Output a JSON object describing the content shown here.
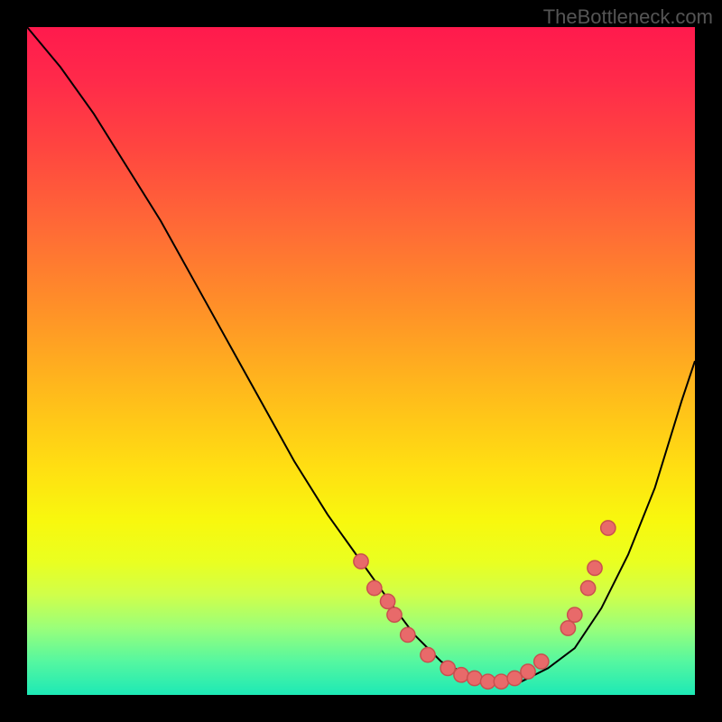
{
  "attribution": "TheBottleneck.com",
  "chart_data": {
    "type": "line",
    "title": "",
    "xlabel": "",
    "ylabel": "",
    "xlim": [
      0,
      100
    ],
    "ylim": [
      0,
      100
    ],
    "series": [
      {
        "name": "curve",
        "x": [
          0,
          5,
          10,
          15,
          20,
          25,
          30,
          35,
          40,
          45,
          50,
          55,
          58,
          62,
          66,
          70,
          74,
          78,
          82,
          86,
          90,
          94,
          98,
          100
        ],
        "y": [
          100,
          94,
          87,
          79,
          71,
          62,
          53,
          44,
          35,
          27,
          20,
          13,
          9,
          5,
          3,
          2,
          2,
          4,
          7,
          13,
          21,
          31,
          44,
          50
        ]
      }
    ],
    "markers": [
      {
        "x": 50,
        "y": 20
      },
      {
        "x": 52,
        "y": 16
      },
      {
        "x": 54,
        "y": 14
      },
      {
        "x": 55,
        "y": 12
      },
      {
        "x": 57,
        "y": 9
      },
      {
        "x": 60,
        "y": 6
      },
      {
        "x": 63,
        "y": 4
      },
      {
        "x": 65,
        "y": 3
      },
      {
        "x": 67,
        "y": 2.5
      },
      {
        "x": 69,
        "y": 2
      },
      {
        "x": 71,
        "y": 2
      },
      {
        "x": 73,
        "y": 2.5
      },
      {
        "x": 75,
        "y": 3.5
      },
      {
        "x": 77,
        "y": 5
      },
      {
        "x": 81,
        "y": 10
      },
      {
        "x": 82,
        "y": 12
      },
      {
        "x": 84,
        "y": 16
      },
      {
        "x": 85,
        "y": 19
      },
      {
        "x": 87,
        "y": 25
      }
    ],
    "colors": {
      "curve": "#000000",
      "marker_fill": "#e86a6a",
      "marker_stroke": "#c94f4f"
    }
  }
}
